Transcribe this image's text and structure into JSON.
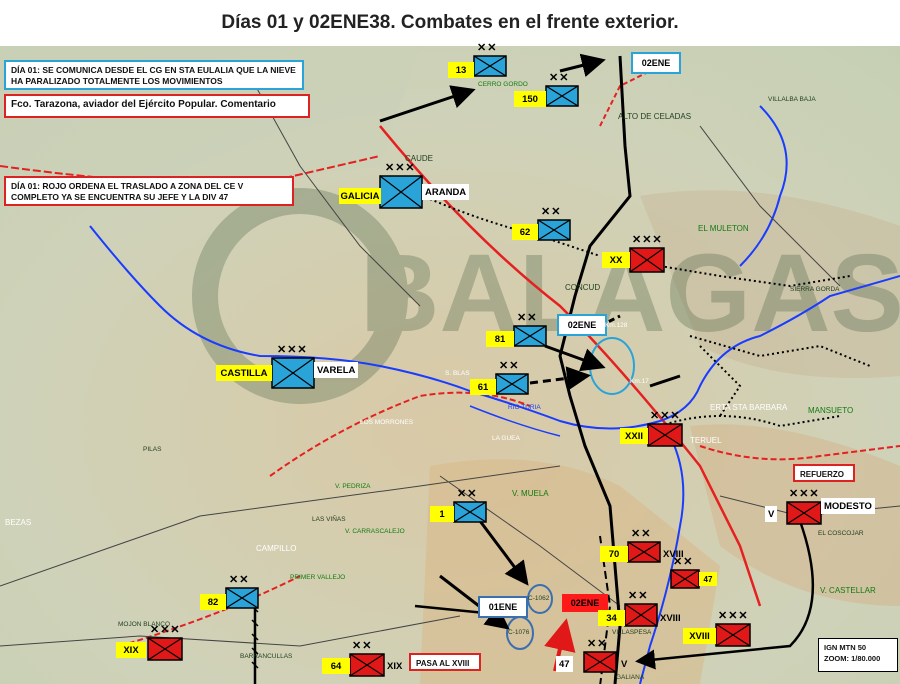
{
  "title": "Días 01 y 02ENE38. Combates en el frente exterior.",
  "notes": {
    "n1": "DÍA 01: SE COMUNICA DESDE EL CG EN STA EULALIA QUE LA NIEVE HA PARALIZADO TOTALMENTE LOS MOVIMIENTOS",
    "n2": "Fco. Tarazona, aviador del Ejército Popular. Comentario",
    "n3": "DÍA 01: ROJO ORDENA EL TRASLADO A ZONA DEL CE V COMPLETO YA SE ENCUENTRA SU JEFE Y LA DIV 47",
    "refuerzo": "REFUERZO",
    "pasa": "PASA AL XVIII",
    "ign": "IGN MTN 50\nZOOM: 1/80.000"
  },
  "dates": {
    "d_top": "02ENE",
    "d_mid": "02ENE",
    "d_01": "01ENE",
    "d_red": "02ENE"
  },
  "units": {
    "u13": "13",
    "u150": "150",
    "galicia": "GALICIA",
    "aranda": "ARANDA",
    "u62": "62",
    "xx": "XX",
    "u81": "81",
    "castilla": "CASTILLA",
    "varela": "VARELA",
    "u61": "61",
    "xxii": "XXII",
    "u1": "1",
    "v_lbl": "V",
    "modesto": "MODESTO",
    "u70": "70",
    "xviii_a": "XVIII",
    "u47": "47",
    "u34": "34",
    "xviii_b": "XVIII",
    "xviii_c": "XVIII",
    "u82": "82",
    "xix": "XIX",
    "u64": "64",
    "xix_b": "XIX",
    "u47b": "47",
    "v_b": "V"
  },
  "places": {
    "cerro_gordo": "CERRO GORDO",
    "villalba": "VILLALBA BAJA",
    "alto_celadas": "ALTO DE CELADAS",
    "caude": "CAUDE",
    "el_muleton": "EL MULETON",
    "concud": "CONCUD",
    "sierra_gorda": "SIERRA GORDA",
    "km128": "Km.128",
    "km17": "Km.17",
    "erta": "ERTA STA BARBARA",
    "mansueto": "MANSUETO",
    "rio_turia": "RIO TURIA",
    "los_morrones": "LOS MORRONES",
    "la_guea": "LA GUEA",
    "teruel": "TERUEL",
    "v_muela": "V. MUELA",
    "v_pedriza": "V. PEDRIZA",
    "bezas": "BEZAS",
    "campillo": "CAMPILLO",
    "v_carrascalejo": "V. CARRASCALEJO",
    "las_vinas": "LAS VIÑAS",
    "primer_vallejo": "PRIMER VALLEJO",
    "mojon_blanco": "MOJON BLANCO",
    "barrancullas": "BARRANCULLAS",
    "v_castellar": "V. CASTELLAR",
    "c1062": "C-1062",
    "c1076": "C-1076",
    "villaspesa": "VILLASPESA",
    "galiana": "GALIANA",
    "pilas": "PILAS",
    "el_coscojar": "EL COSCOJAR",
    "s_blas": "S. BLAS"
  },
  "watermark": "BALAGAS",
  "colors": {
    "nationalist": "#2aa3d8",
    "republican": "#e01818",
    "label_bg": "#ffff00",
    "front_line": "#000000",
    "river": "#1a3cff",
    "road": "#e52020"
  }
}
